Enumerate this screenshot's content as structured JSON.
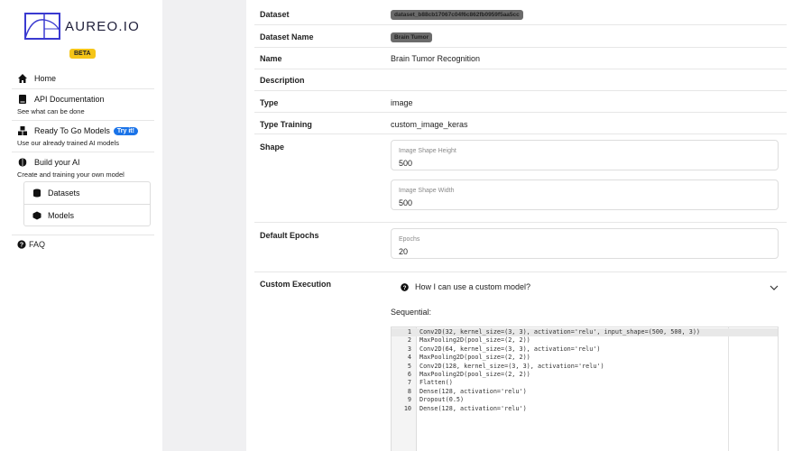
{
  "brand": {
    "name": "AUREO.IO",
    "badge": "BETA"
  },
  "sidebar": {
    "home": "Home",
    "api": {
      "label": "API Documentation",
      "sub": "See what can be done"
    },
    "ready": {
      "label": "Ready To Go Models",
      "badge": "Try it!",
      "sub": "Use our already trained AI models"
    },
    "build": {
      "label": "Build your AI",
      "sub": "Create and training your own model"
    },
    "datasets": "Datasets",
    "models": "Models",
    "faq": "FAQ"
  },
  "details": {
    "dataset": {
      "label": "Dataset",
      "value": "dataset_b88cb17067c04f6c862fb0959f5aa5cc"
    },
    "dataset_name": {
      "label": "Dataset Name",
      "value": "Brain Tumor"
    },
    "name": {
      "label": "Name",
      "value": "Brain Tumor Recognition"
    },
    "description": {
      "label": "Description",
      "value": ""
    },
    "type": {
      "label": "Type",
      "value": "image"
    },
    "type_training": {
      "label": "Type Training",
      "value": "custom_image_keras"
    },
    "shape": {
      "label": "Shape",
      "height_label": "Image Shape Height",
      "height_value": "500",
      "width_label": "Image Shape Width",
      "width_value": "500"
    },
    "epochs": {
      "label": "Default Epochs",
      "field_label": "Epochs",
      "value": "20"
    },
    "custom": {
      "label": "Custom Execution",
      "question": "How I can use a custom model?",
      "sequential": "Sequential:"
    }
  },
  "code": [
    {
      "n": "1",
      "text": "Conv2D(32, kernel_size=(3, 3), activation='relu', input_shape=(500, 500, 3))"
    },
    {
      "n": "2",
      "text": "MaxPooling2D(pool_size=(2, 2))"
    },
    {
      "n": "3",
      "text": "Conv2D(64, kernel_size=(3, 3), activation='relu')"
    },
    {
      "n": "4",
      "text": "MaxPooling2D(pool_size=(2, 2))"
    },
    {
      "n": "5",
      "text": "Conv2D(128, kernel_size=(3, 3), activation='relu')"
    },
    {
      "n": "6",
      "text": "MaxPooling2D(pool_size=(2, 2))"
    },
    {
      "n": "7",
      "text": "Flatten()"
    },
    {
      "n": "8",
      "text": "Dense(128, activation='relu')"
    },
    {
      "n": "9",
      "text": "Dropout(0.5)"
    },
    {
      "n": "10",
      "text": "Dense(128, activation='relu')"
    }
  ]
}
